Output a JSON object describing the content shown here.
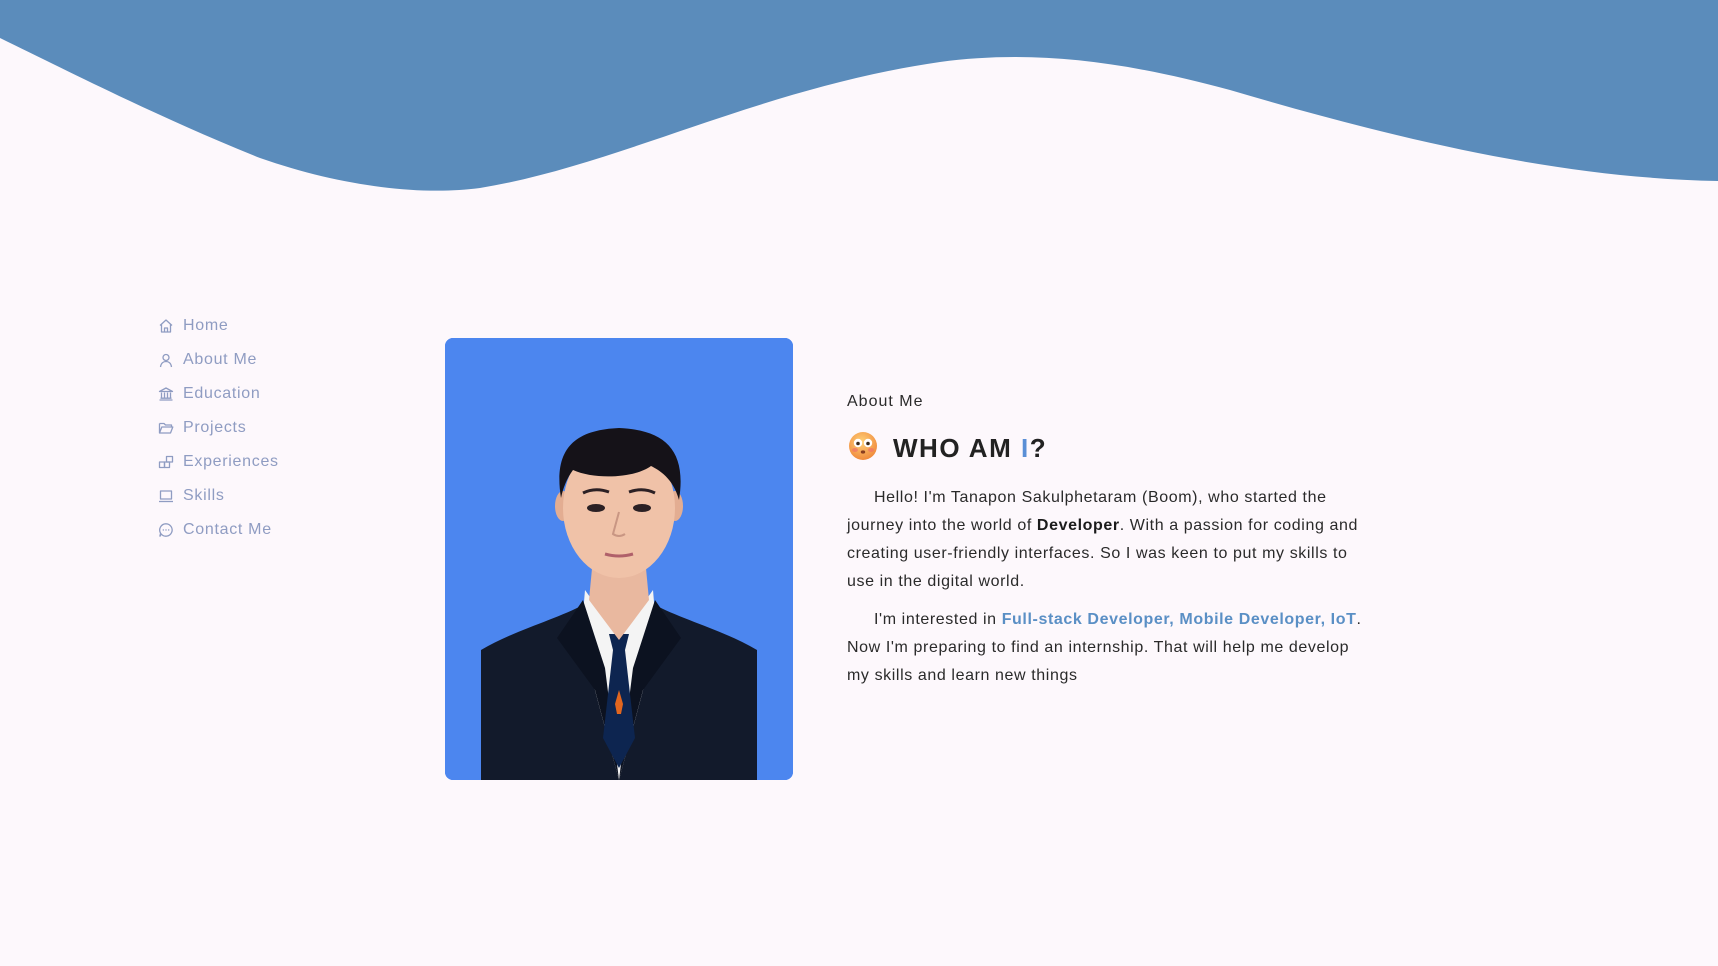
{
  "theme": {
    "wave_color": "#5b8cbb",
    "background": "#fdf8fc",
    "nav_text_color": "#8f9cc2",
    "accent": "#5a8fd6",
    "photo_background": "#4c86ef"
  },
  "nav": {
    "items": [
      {
        "label": "Home",
        "icon": "home-icon"
      },
      {
        "label": "About Me",
        "icon": "user-icon"
      },
      {
        "label": "Education",
        "icon": "institution-icon"
      },
      {
        "label": "Projects",
        "icon": "folder-icon"
      },
      {
        "label": "Experiences",
        "icon": "blocks-icon"
      },
      {
        "label": "Skills",
        "icon": "laptop-icon"
      },
      {
        "label": "Contact Me",
        "icon": "chat-icon"
      }
    ]
  },
  "about": {
    "eyebrow": "About Me",
    "emoji": "flushed-face-emoji",
    "heading_prefix": "WHO AM ",
    "heading_accent": "I",
    "heading_suffix": "?",
    "p1_pre": "Hello! I'm Tanapon Sakulphetaram (Boom), who started the journey into the world of ",
    "p1_bold": "Developer",
    "p1_post": ". With a passion for coding and creating user-friendly interfaces. So I was keen to put my skills to use in the digital world.",
    "p2_pre": "I'm interested in ",
    "p2_link": "Full-stack Developer, Mobile Developer, IoT",
    "p2_post": ". Now I'm preparing to find an internship. That will help me develop my skills and learn new things"
  }
}
